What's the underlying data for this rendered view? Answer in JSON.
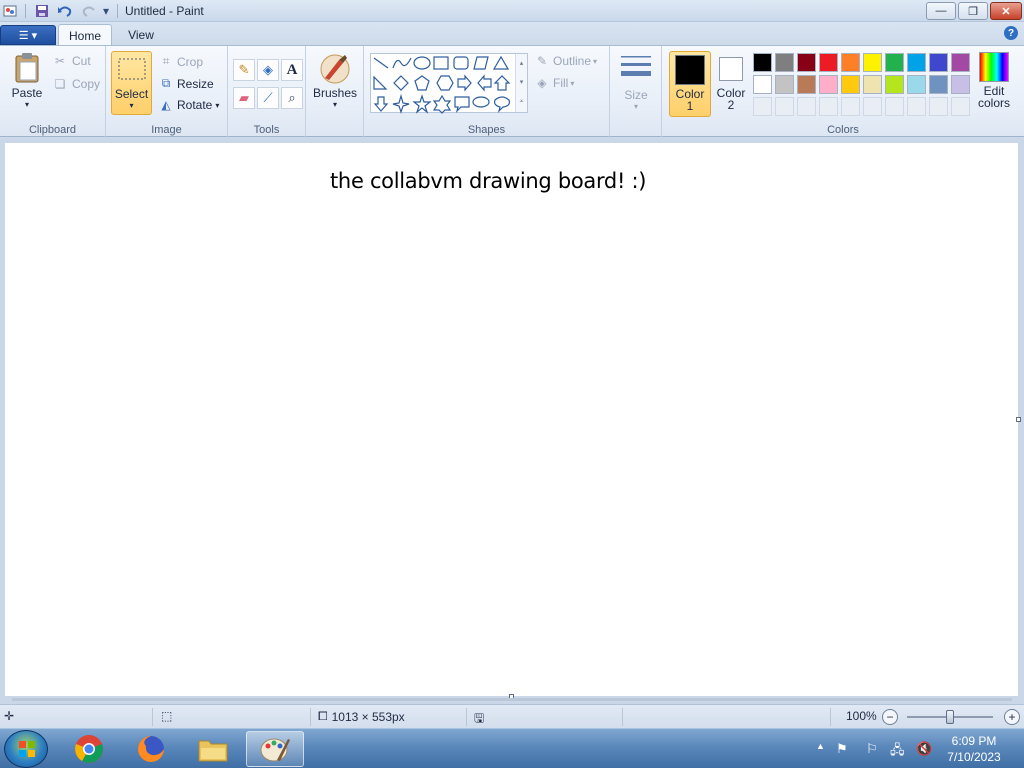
{
  "window": {
    "title": "Untitled - Paint"
  },
  "tabs": [
    {
      "label": "Home"
    },
    {
      "label": "View"
    }
  ],
  "clipboard": {
    "paste": "Paste",
    "cut": "Cut",
    "copy": "Copy",
    "group": "Clipboard"
  },
  "image": {
    "select": "Select",
    "crop": "Crop",
    "resize": "Resize",
    "rotate": "Rotate",
    "group": "Image"
  },
  "tools": {
    "group": "Tools"
  },
  "brushes": {
    "label": "Brushes"
  },
  "shapes": {
    "outline": "Outline",
    "fill": "Fill",
    "group": "Shapes"
  },
  "size": {
    "label": "Size"
  },
  "colors": {
    "color1_a": "Color",
    "color1_b": "1",
    "color2_a": "Color",
    "color2_b": "2",
    "edit_a": "Edit",
    "edit_b": "colors",
    "group": "Colors",
    "row1": [
      "#000000",
      "#7f7f7f",
      "#880015",
      "#ed1c24",
      "#ff7f27",
      "#fff200",
      "#22b14c",
      "#00a2e8",
      "#3f48cc",
      "#a349a4"
    ],
    "row2": [
      "#ffffff",
      "#c3c3c3",
      "#b97a57",
      "#ffaec9",
      "#ffc90e",
      "#efe4b0",
      "#b5e61d",
      "#99d9ea",
      "#7092be",
      "#c8bfe7"
    ]
  },
  "canvas": {
    "text": "the collabvm drawing board! :)"
  },
  "status": {
    "dimensions": "1013 × 553px",
    "zoom": "100%"
  },
  "taskbar": {
    "time": "6:09 PM",
    "date": "7/10/2023"
  }
}
